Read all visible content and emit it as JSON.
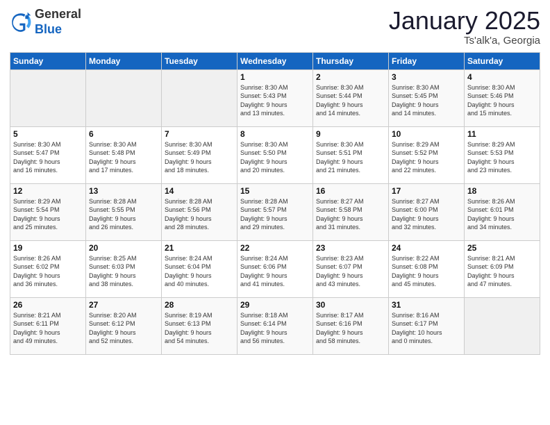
{
  "header": {
    "logo_general": "General",
    "logo_blue": "Blue",
    "month": "January 2025",
    "location": "Ts'alk'a, Georgia"
  },
  "days_of_week": [
    "Sunday",
    "Monday",
    "Tuesday",
    "Wednesday",
    "Thursday",
    "Friday",
    "Saturday"
  ],
  "weeks": [
    [
      {
        "num": "",
        "info": ""
      },
      {
        "num": "",
        "info": ""
      },
      {
        "num": "",
        "info": ""
      },
      {
        "num": "1",
        "info": "Sunrise: 8:30 AM\nSunset: 5:43 PM\nDaylight: 9 hours\nand 13 minutes."
      },
      {
        "num": "2",
        "info": "Sunrise: 8:30 AM\nSunset: 5:44 PM\nDaylight: 9 hours\nand 14 minutes."
      },
      {
        "num": "3",
        "info": "Sunrise: 8:30 AM\nSunset: 5:45 PM\nDaylight: 9 hours\nand 14 minutes."
      },
      {
        "num": "4",
        "info": "Sunrise: 8:30 AM\nSunset: 5:46 PM\nDaylight: 9 hours\nand 15 minutes."
      }
    ],
    [
      {
        "num": "5",
        "info": "Sunrise: 8:30 AM\nSunset: 5:47 PM\nDaylight: 9 hours\nand 16 minutes."
      },
      {
        "num": "6",
        "info": "Sunrise: 8:30 AM\nSunset: 5:48 PM\nDaylight: 9 hours\nand 17 minutes."
      },
      {
        "num": "7",
        "info": "Sunrise: 8:30 AM\nSunset: 5:49 PM\nDaylight: 9 hours\nand 18 minutes."
      },
      {
        "num": "8",
        "info": "Sunrise: 8:30 AM\nSunset: 5:50 PM\nDaylight: 9 hours\nand 20 minutes."
      },
      {
        "num": "9",
        "info": "Sunrise: 8:30 AM\nSunset: 5:51 PM\nDaylight: 9 hours\nand 21 minutes."
      },
      {
        "num": "10",
        "info": "Sunrise: 8:29 AM\nSunset: 5:52 PM\nDaylight: 9 hours\nand 22 minutes."
      },
      {
        "num": "11",
        "info": "Sunrise: 8:29 AM\nSunset: 5:53 PM\nDaylight: 9 hours\nand 23 minutes."
      }
    ],
    [
      {
        "num": "12",
        "info": "Sunrise: 8:29 AM\nSunset: 5:54 PM\nDaylight: 9 hours\nand 25 minutes."
      },
      {
        "num": "13",
        "info": "Sunrise: 8:28 AM\nSunset: 5:55 PM\nDaylight: 9 hours\nand 26 minutes."
      },
      {
        "num": "14",
        "info": "Sunrise: 8:28 AM\nSunset: 5:56 PM\nDaylight: 9 hours\nand 28 minutes."
      },
      {
        "num": "15",
        "info": "Sunrise: 8:28 AM\nSunset: 5:57 PM\nDaylight: 9 hours\nand 29 minutes."
      },
      {
        "num": "16",
        "info": "Sunrise: 8:27 AM\nSunset: 5:58 PM\nDaylight: 9 hours\nand 31 minutes."
      },
      {
        "num": "17",
        "info": "Sunrise: 8:27 AM\nSunset: 6:00 PM\nDaylight: 9 hours\nand 32 minutes."
      },
      {
        "num": "18",
        "info": "Sunrise: 8:26 AM\nSunset: 6:01 PM\nDaylight: 9 hours\nand 34 minutes."
      }
    ],
    [
      {
        "num": "19",
        "info": "Sunrise: 8:26 AM\nSunset: 6:02 PM\nDaylight: 9 hours\nand 36 minutes."
      },
      {
        "num": "20",
        "info": "Sunrise: 8:25 AM\nSunset: 6:03 PM\nDaylight: 9 hours\nand 38 minutes."
      },
      {
        "num": "21",
        "info": "Sunrise: 8:24 AM\nSunset: 6:04 PM\nDaylight: 9 hours\nand 40 minutes."
      },
      {
        "num": "22",
        "info": "Sunrise: 8:24 AM\nSunset: 6:06 PM\nDaylight: 9 hours\nand 41 minutes."
      },
      {
        "num": "23",
        "info": "Sunrise: 8:23 AM\nSunset: 6:07 PM\nDaylight: 9 hours\nand 43 minutes."
      },
      {
        "num": "24",
        "info": "Sunrise: 8:22 AM\nSunset: 6:08 PM\nDaylight: 9 hours\nand 45 minutes."
      },
      {
        "num": "25",
        "info": "Sunrise: 8:21 AM\nSunset: 6:09 PM\nDaylight: 9 hours\nand 47 minutes."
      }
    ],
    [
      {
        "num": "26",
        "info": "Sunrise: 8:21 AM\nSunset: 6:11 PM\nDaylight: 9 hours\nand 49 minutes."
      },
      {
        "num": "27",
        "info": "Sunrise: 8:20 AM\nSunset: 6:12 PM\nDaylight: 9 hours\nand 52 minutes."
      },
      {
        "num": "28",
        "info": "Sunrise: 8:19 AM\nSunset: 6:13 PM\nDaylight: 9 hours\nand 54 minutes."
      },
      {
        "num": "29",
        "info": "Sunrise: 8:18 AM\nSunset: 6:14 PM\nDaylight: 9 hours\nand 56 minutes."
      },
      {
        "num": "30",
        "info": "Sunrise: 8:17 AM\nSunset: 6:16 PM\nDaylight: 9 hours\nand 58 minutes."
      },
      {
        "num": "31",
        "info": "Sunrise: 8:16 AM\nSunset: 6:17 PM\nDaylight: 10 hours\nand 0 minutes."
      },
      {
        "num": "",
        "info": ""
      }
    ]
  ]
}
